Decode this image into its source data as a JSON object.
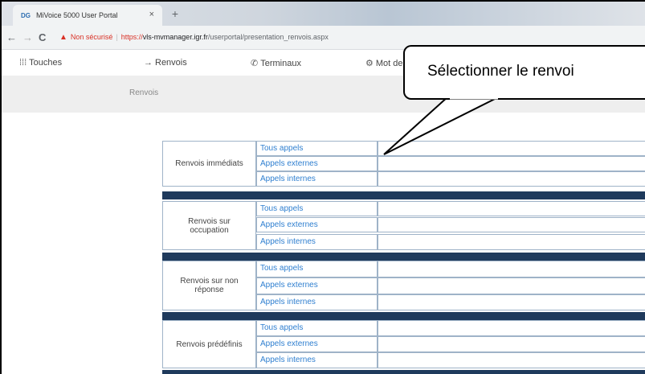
{
  "browser": {
    "tab_title": "MiVoice 5000 User Portal",
    "tab_close": "×",
    "new_tab": "+",
    "favicon_text": "DG",
    "warning_label": "Non sécurisé",
    "url_proto": "https://",
    "url_host": "vls-mvmanager.igr.fr",
    "url_path": "/userportal/presentation_renvois.aspx",
    "back_icon": "←",
    "forward_icon": "→",
    "reload_icon": "C",
    "warn_icon": "▲"
  },
  "nav": {
    "items": [
      {
        "icon": "⁞⁞⁞",
        "label": "Touches"
      },
      {
        "icon": "→",
        "label": "Renvois"
      },
      {
        "icon": "✆",
        "label": "Terminaux"
      },
      {
        "icon": "⚙",
        "label": "Mot de passe"
      }
    ]
  },
  "subbar": {
    "label": "Renvois"
  },
  "groups": [
    {
      "name": "Renvois immédiats",
      "options": [
        "Tous appels",
        "Appels externes",
        "Appels internes"
      ]
    },
    {
      "name": "Renvois sur occupation",
      "options": [
        "Tous appels",
        "Appels externes",
        "Appels internes"
      ]
    },
    {
      "name": "Renvois sur non réponse",
      "options": [
        "Tous appels",
        "Appels externes",
        "Appels internes"
      ]
    },
    {
      "name": "Renvois prédéfinis",
      "options": [
        "Tous appels",
        "Appels externes",
        "Appels internes"
      ]
    }
  ],
  "callout": {
    "text": "Sélectionner le renvoi"
  },
  "colors": {
    "link": "#2f7fd0",
    "divider": "#1f3a5c",
    "border": "#9fb3c8"
  }
}
